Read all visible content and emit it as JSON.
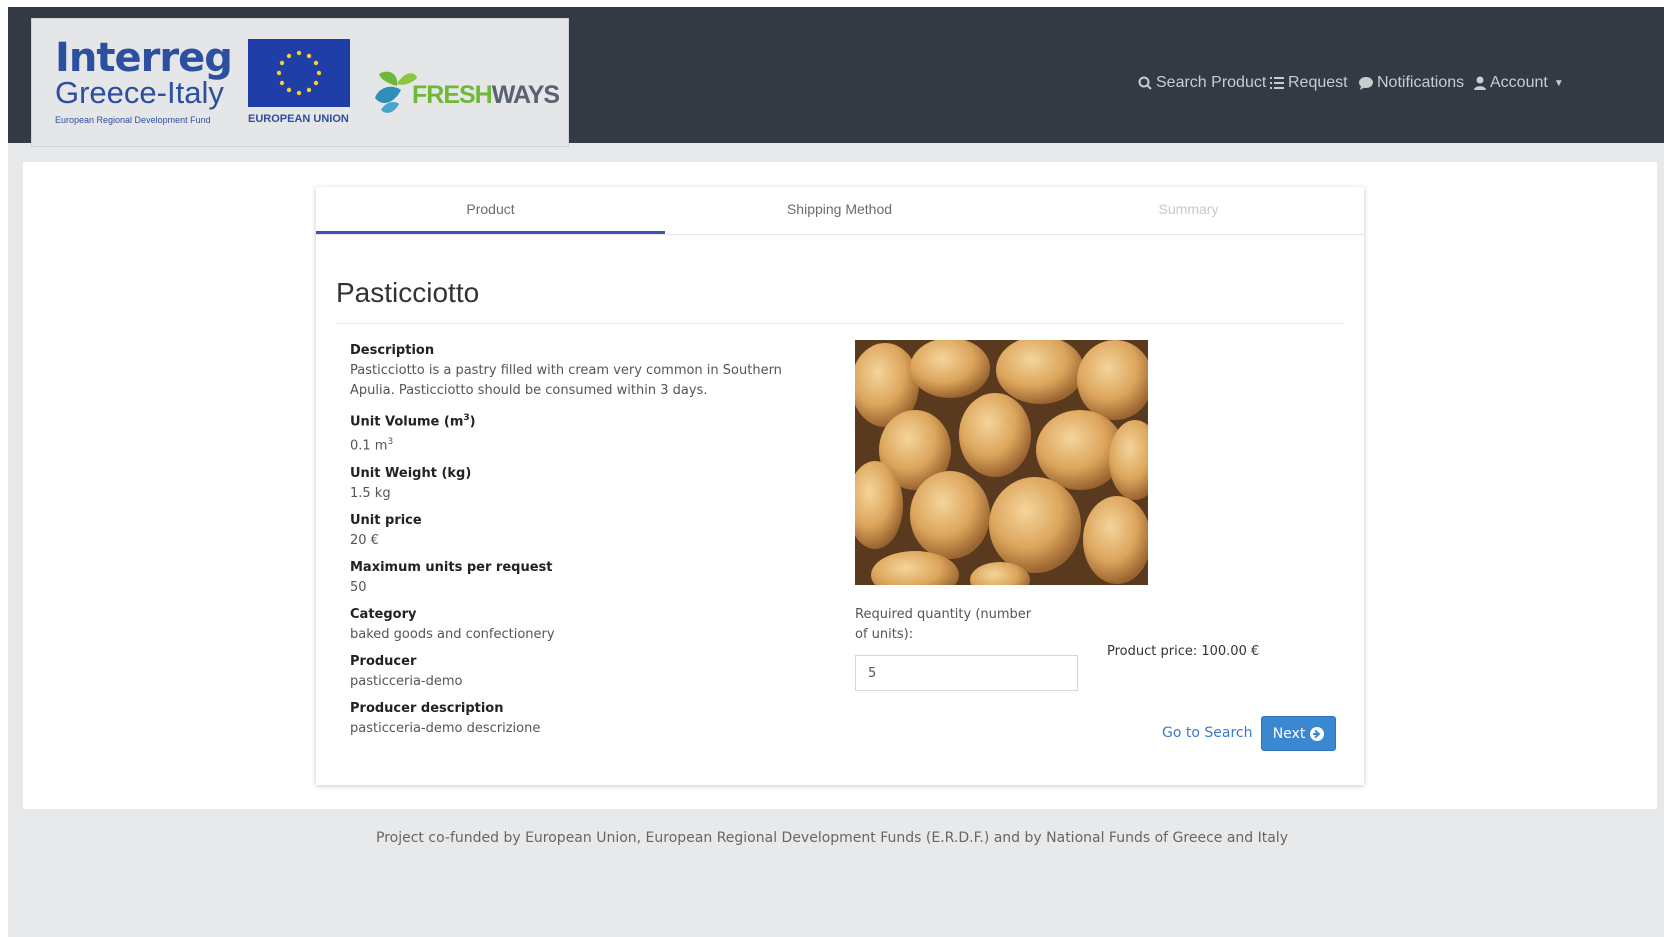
{
  "logo": {
    "interreg_title": "Interreg",
    "interreg_subtitle": "Greece-Italy",
    "interreg_fund": "European Regional Development Fund",
    "eu_label": "EUROPEAN UNION",
    "freshways_fresh": "FRESH",
    "freshways_ways": "WAYS"
  },
  "nav": {
    "search": "Search Product",
    "request": "Request",
    "notifications": "Notifications",
    "account": "Account"
  },
  "tabs": {
    "product": "Product",
    "shipping": "Shipping Method",
    "summary": "Summary"
  },
  "product": {
    "title": "Pasticciotto",
    "description_label": "Description",
    "description": "Pasticciotto is a pastry filled with cream very common in Southern Apulia. Pasticciotto should be consumed within 3 days.",
    "unit_volume_label": "Unit Volume (m",
    "unit_volume_label_sup": "3",
    "unit_volume_label_end": ")",
    "unit_volume_value": "0.1 m",
    "unit_volume_value_sup": "3",
    "unit_weight_label": "Unit Weight (kg)",
    "unit_weight_value": "1.5 kg",
    "unit_price_label": "Unit price",
    "unit_price_value": "20 €",
    "max_units_label": "Maximum units per request",
    "max_units_value": "50",
    "category_label": "Category",
    "category_value": "baked goods and confectionery",
    "producer_label": "Producer",
    "producer_value": "pasticceria-demo",
    "producer_desc_label": "Producer description",
    "producer_desc_value": "pasticceria-demo descrizione"
  },
  "order": {
    "quantity_label": "Required quantity (number of units):",
    "quantity_value": "5",
    "price_text": "Product price: 100.00 €",
    "go_search": "Go to Search",
    "next": "Next"
  },
  "footer": {
    "text": "Project co-funded by European Union, European Regional Development Funds (E.R.D.F.) and by National Funds of Greece and Italy"
  },
  "colors": {
    "header_bg": "#343a44",
    "accent": "#3a87d2",
    "tab_indicator": "#3a56b0"
  }
}
